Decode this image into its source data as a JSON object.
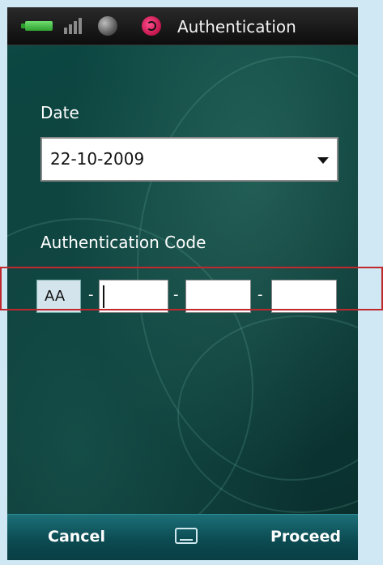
{
  "status_bar": {
    "title": "Authentication",
    "icons": [
      "battery-icon",
      "signal-icon",
      "globe-icon",
      "app-icon"
    ]
  },
  "form": {
    "date_label": "Date",
    "date_value": "22-10-2009",
    "auth_code_label": "Authentication Code",
    "auth_prefix": "AA",
    "separator": "-",
    "code_fields": [
      "",
      "",
      ""
    ]
  },
  "softkeys": {
    "left": "Cancel",
    "right": "Proceed",
    "center_icon": "keyboard-icon"
  },
  "colors": {
    "background_top": "#0d4a45",
    "background_bottom": "#0a2f2d",
    "highlight_border": "#c0282d",
    "softkey_bar": "#0c4b52",
    "prefix_box": "#d4e4ec"
  }
}
